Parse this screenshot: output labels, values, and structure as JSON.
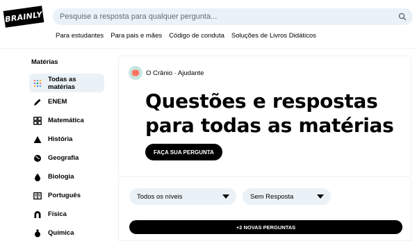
{
  "header": {
    "logo_text": "BRAINLY",
    "search_placeholder": "Pesquise a resposta para qualquer pergunta...",
    "nav": [
      "Para estudantes",
      "Para pais e mães",
      "Código de conduta",
      "Soluções de Livros Didáticos"
    ]
  },
  "sidebar": {
    "title": "Matérias",
    "items": [
      {
        "label": "Todas as matérias",
        "icon": "grid-dots-icon",
        "active": true
      },
      {
        "label": "ENEM",
        "icon": "pencil-icon"
      },
      {
        "label": "Matemática",
        "icon": "calculator-icon"
      },
      {
        "label": "História",
        "icon": "pyramid-icon"
      },
      {
        "label": "Geografia",
        "icon": "globe-icon"
      },
      {
        "label": "Biologia",
        "icon": "leaf-drop-icon"
      },
      {
        "label": "Português",
        "icon": "book-icon"
      },
      {
        "label": "Física",
        "icon": "magnet-icon"
      },
      {
        "label": "Química",
        "icon": "flask-icon"
      }
    ]
  },
  "card": {
    "author": "O Crânio · Ajudante",
    "headline_line1": "Questões e respostas",
    "headline_line2": "para todas as matérias",
    "ask_button": "FAÇA SUA PERGUNTA"
  },
  "filters": {
    "level_selected": "Todos os níveis",
    "status_selected": "Sem Resposta",
    "new_questions_button": "+2 NOVAS PERGUNTAS"
  },
  "colors": {
    "accent_bg": "#ebf2f7",
    "primary": "#000000",
    "avatar_bg": "#c7e6e2",
    "brain_pink": "#ff7968"
  }
}
